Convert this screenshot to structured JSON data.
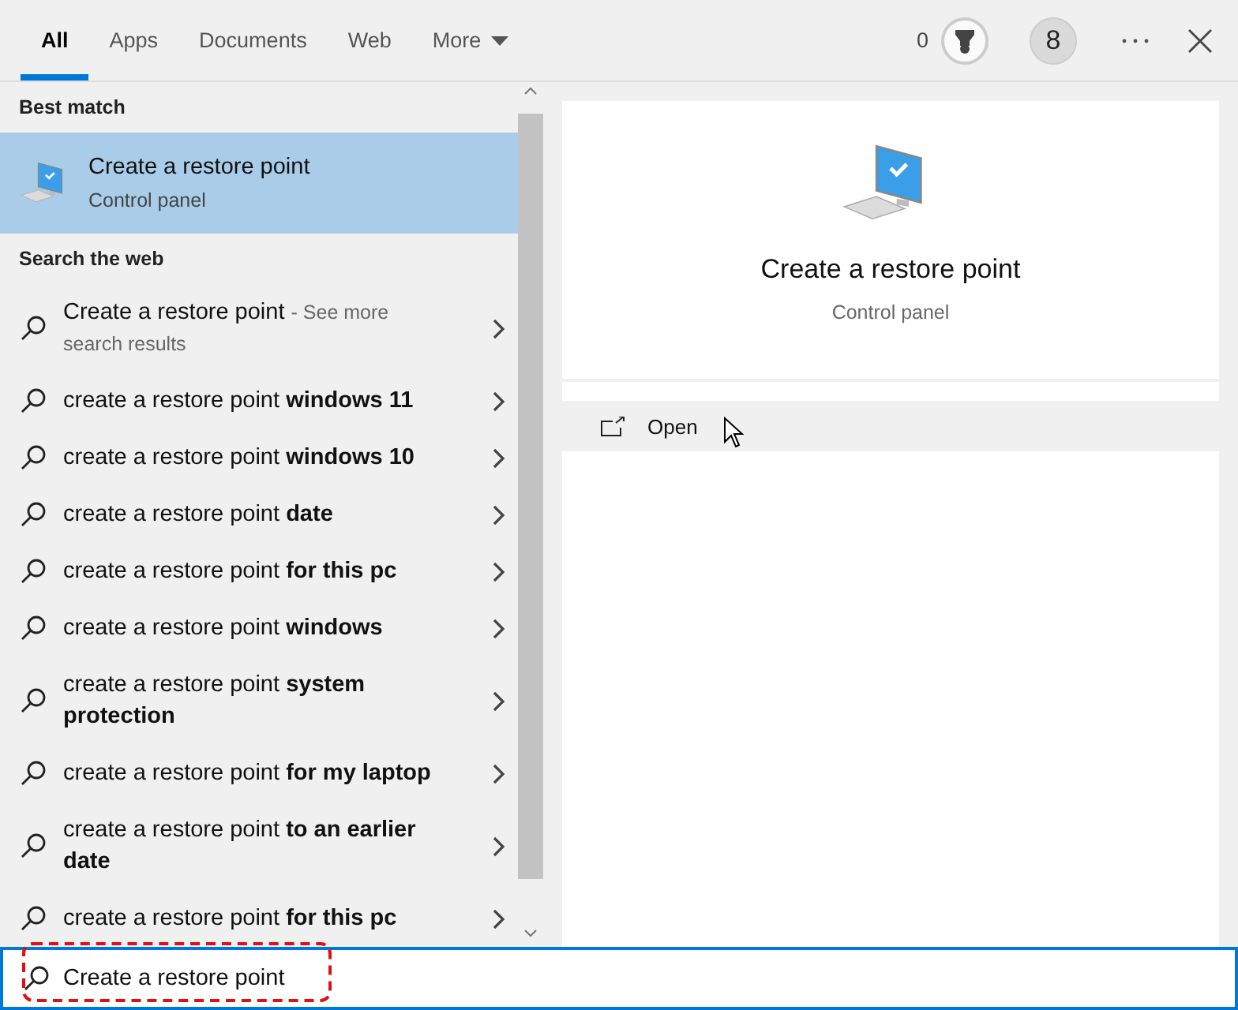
{
  "tabs": [
    {
      "label": "All",
      "selected": true
    },
    {
      "label": "Apps",
      "selected": false
    },
    {
      "label": "Documents",
      "selected": false
    },
    {
      "label": "Web",
      "selected": false
    },
    {
      "label": "More",
      "selected": false,
      "kind": "dropdown"
    }
  ],
  "header_actions": {
    "points": "0",
    "avatar": "8"
  },
  "best_match": {
    "heading": "Best match",
    "title": "Create a restore point",
    "subtitle": "Control panel",
    "selected": true
  },
  "web": {
    "heading": "Search the web",
    "items": [
      {
        "text": "Create a restore point",
        "note": "- See more search results",
        "selected": false
      },
      {
        "text": "create a restore point **windows 11**",
        "selected": false
      },
      {
        "text": "create a restore point **windows 10**",
        "selected": false
      },
      {
        "text": "create a restore point **date**",
        "selected": false
      },
      {
        "text": "create a restore point **for this pc**",
        "selected": false
      },
      {
        "text": "create a restore point **windows**",
        "selected": false
      },
      {
        "text": "create a restore point **system protection**",
        "selected": false
      },
      {
        "text": "create a restore point **for my laptop**",
        "selected": false
      },
      {
        "text": "create a restore point **to an earlier date**",
        "selected": false
      },
      {
        "text": "create a restore point **for this pc**",
        "selected": false
      }
    ]
  },
  "preview": {
    "title": "Create a restore point",
    "subtitle": "Control panel",
    "actions": [
      {
        "label": "Open"
      }
    ]
  },
  "search": {
    "value": "Create a restore point",
    "highlighted": true
  }
}
